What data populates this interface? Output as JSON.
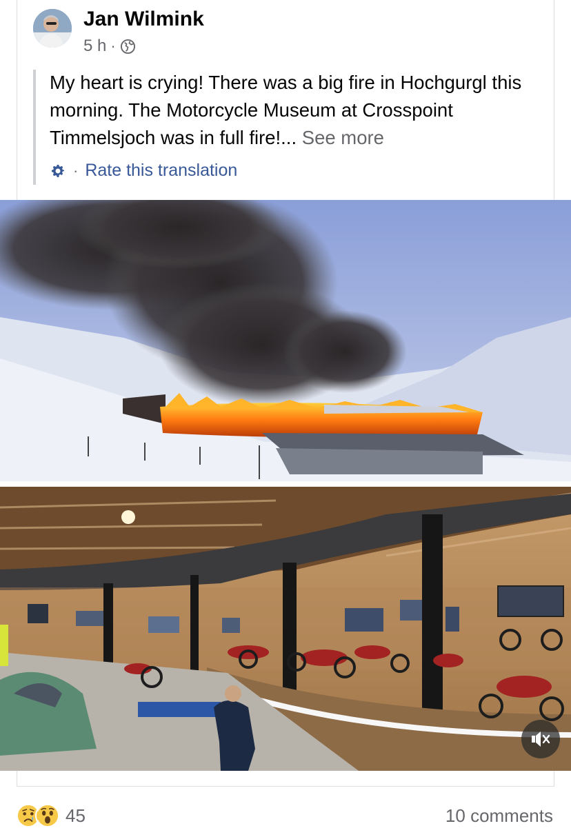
{
  "post": {
    "author": "Jan Wilmink",
    "time": "5 h",
    "separator": "·",
    "privacy_icon": "globe-icon",
    "text": "My heart is crying! There was a big fire in Hochgurgl this morning. The Motorcycle Museum at Crosspoint Timmelsjoch was in full fire!...",
    "see_more": "See more",
    "translation": {
      "icon": "gear-icon",
      "separator": "·",
      "label": "Rate this translation"
    }
  },
  "media": {
    "mute_icon": "speaker-muted-icon"
  },
  "footer": {
    "reaction_icons": [
      "sad-reaction-icon",
      "wow-reaction-icon"
    ],
    "reaction_count": "45",
    "comments": "10 comments"
  },
  "colors": {
    "link": "#385898",
    "secondary_text": "#65676b",
    "divider": "#dcdde1"
  }
}
